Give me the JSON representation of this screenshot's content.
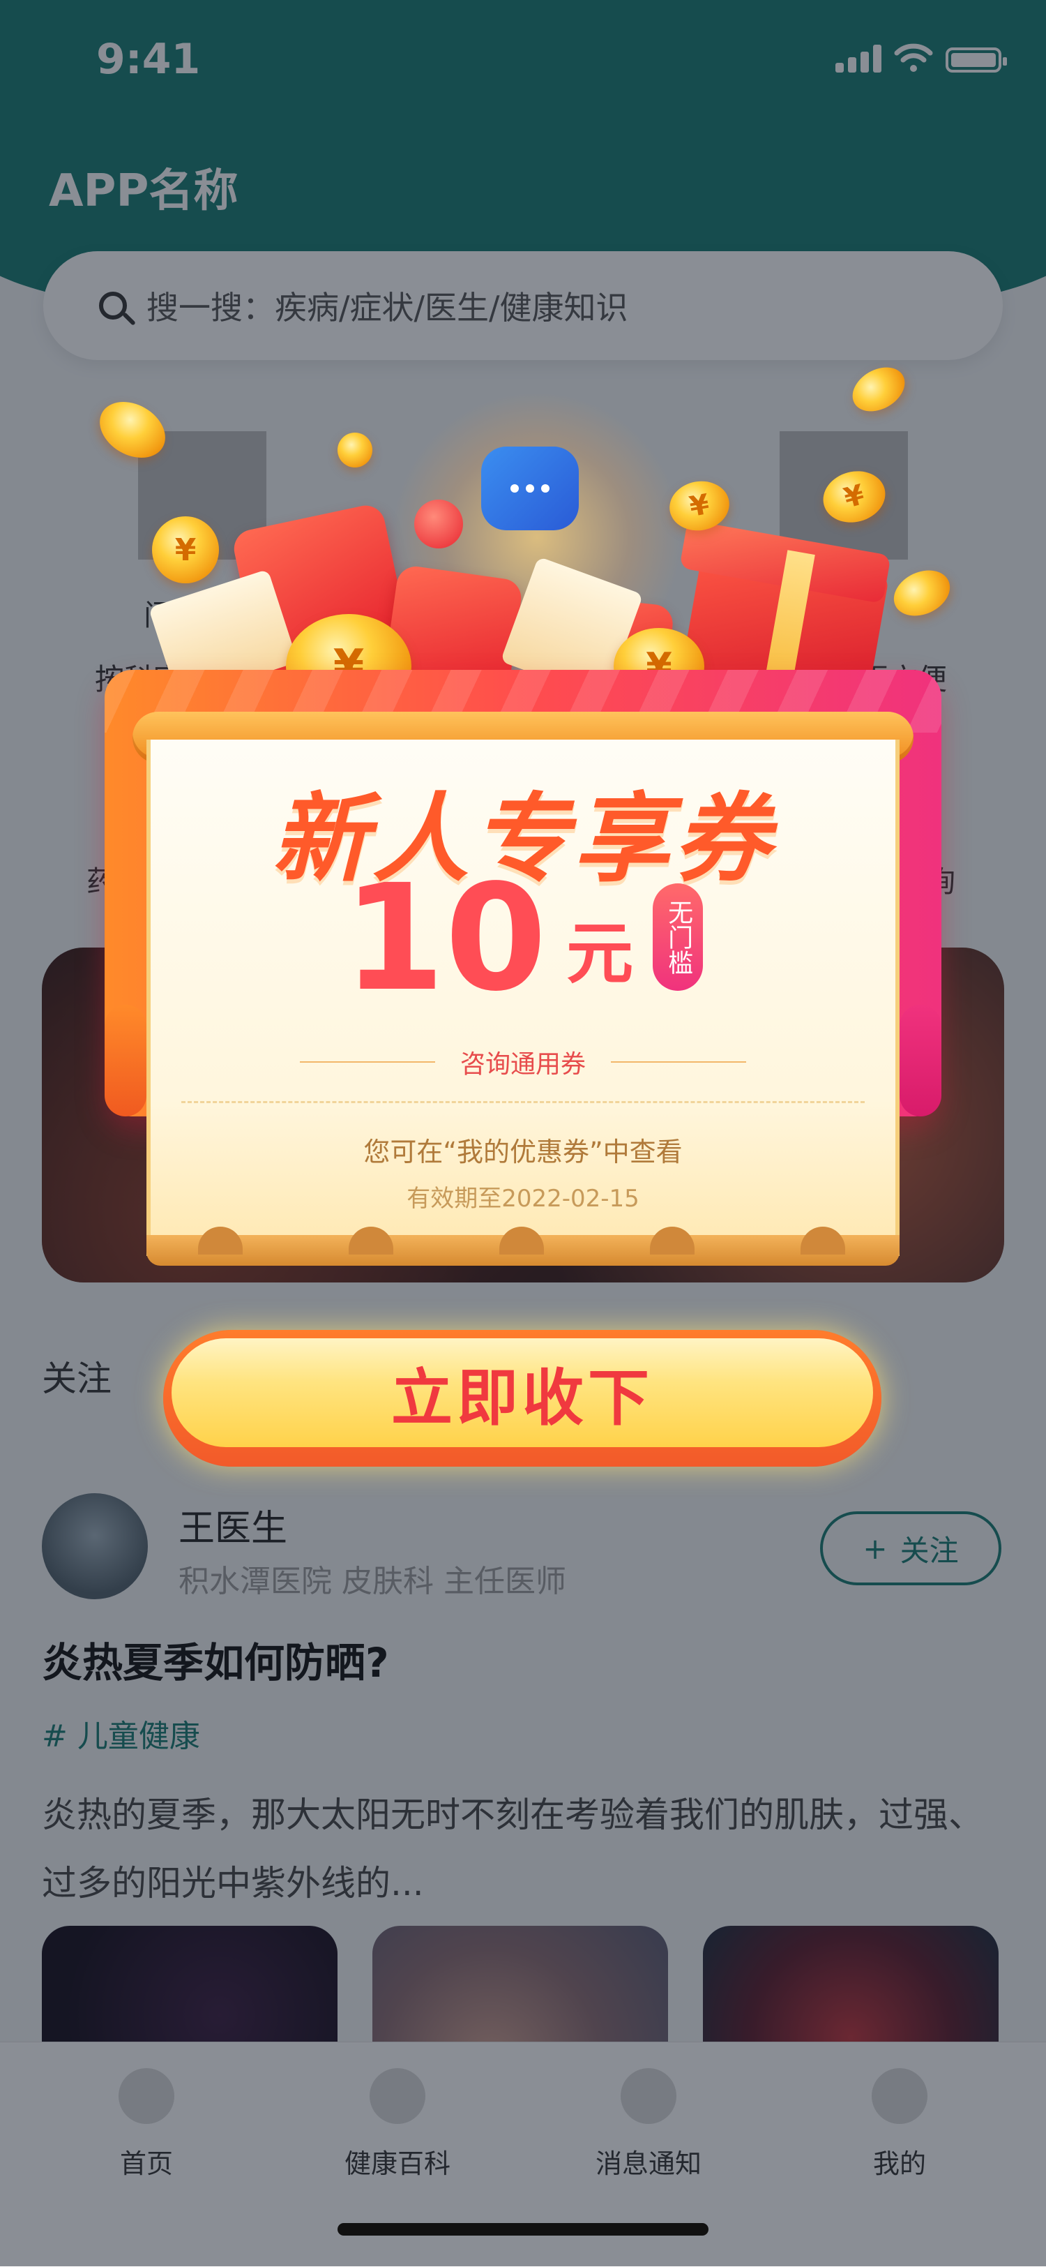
{
  "status_bar": {
    "time": "9:41"
  },
  "header": {
    "app_name": "APP名称",
    "search_placeholder": "搜一搜：疾病/症状/医生/健康知识"
  },
  "quick_entries": {
    "partial_labels": [
      "问",
      "按科室",
      "更方便",
      "药",
      "询"
    ]
  },
  "follow": {
    "section_title": "关注",
    "doctor": {
      "name": "王医生",
      "info": "积水潭医院  皮肤科  主任医师",
      "follow_label": "关注",
      "follow_plus": "+"
    },
    "post": {
      "title": "炎热夏季如何防晒?",
      "tag": "# 儿童健康",
      "body": "炎热的夏季，那大太阳无时不刻在考验着我们的肌肤，过强、过多的阳光中紫外线的..."
    }
  },
  "tab_bar": {
    "tabs": [
      "首页",
      "健康百科",
      "消息通知",
      "我的"
    ]
  },
  "coupon_popup": {
    "title": "新人专享券",
    "amount": "10",
    "unit": "元",
    "badge": "无门槛",
    "type_label": "咨询通用券",
    "hint": "您可在“我的优惠券”中查看",
    "validity": "有效期至2022-02-15",
    "claim_button": "立即收下",
    "coin_symbol": "¥"
  },
  "colors": {
    "brand_teal": "#167a70",
    "coupon_red": "#ff4d55",
    "button_yellow": "#ffe480"
  }
}
